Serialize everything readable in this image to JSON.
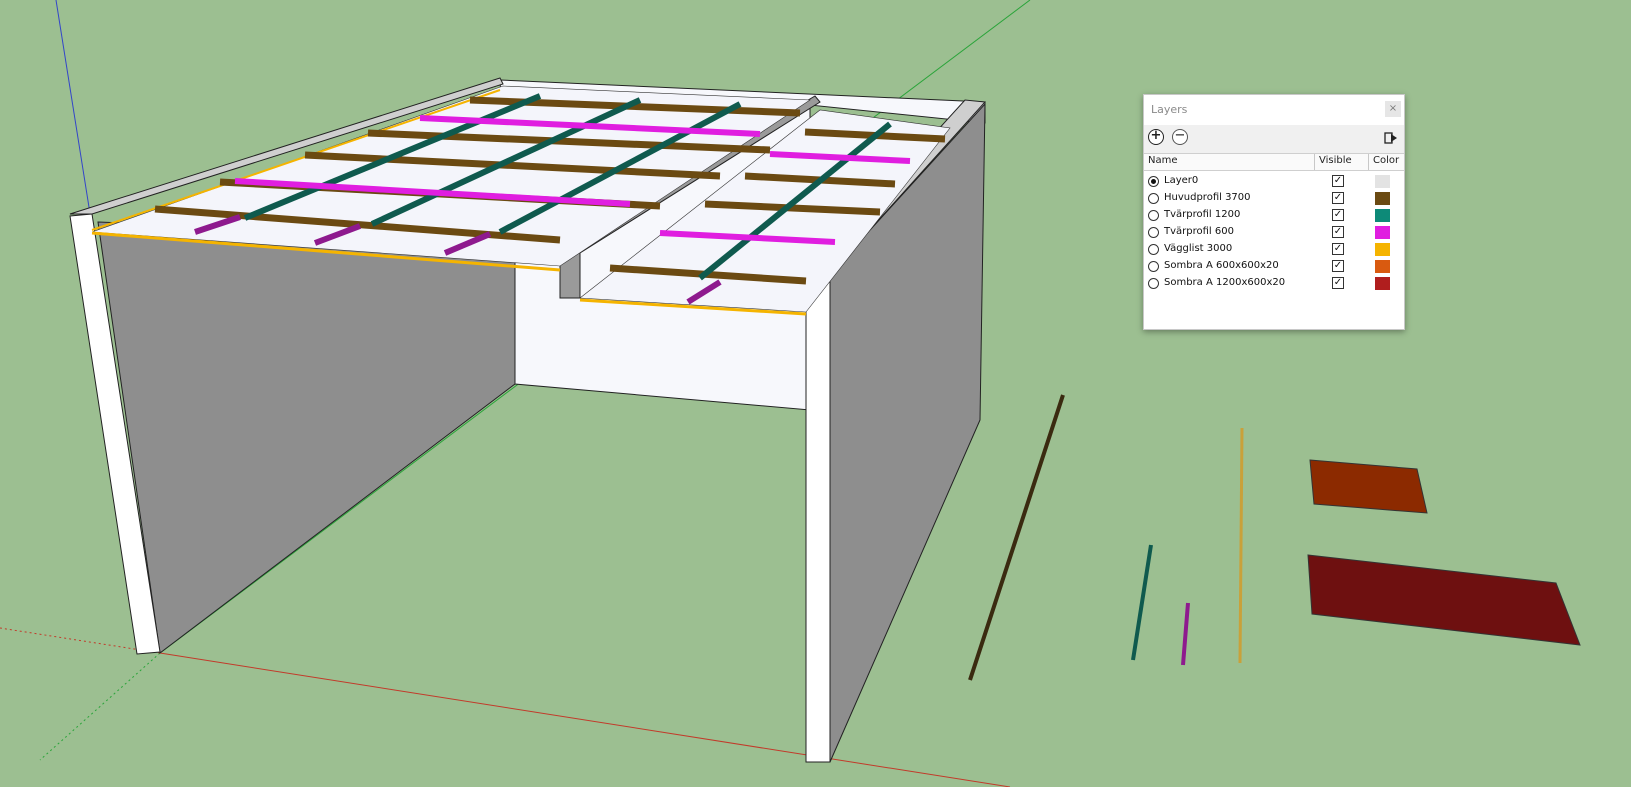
{
  "layers_panel": {
    "title": "Layers",
    "close_glyph": "×",
    "toolbar": {
      "add_glyph": "+",
      "remove_glyph": "−",
      "add_icon": "plus-circle-icon",
      "remove_icon": "minus-circle-icon",
      "details_icon": "details-arrow-icon"
    },
    "columns": {
      "name": "Name",
      "visible": "Visible",
      "color": "Color"
    },
    "check_glyph": "✓",
    "layers": [
      {
        "name": "Layer0",
        "active": true,
        "visible": true,
        "color": "#e3e3e3"
      },
      {
        "name": "Huvudprofil 3700",
        "active": false,
        "visible": true,
        "color": "#6b4a12"
      },
      {
        "name": "Tvärprofil 1200",
        "active": false,
        "visible": true,
        "color": "#0d8a78"
      },
      {
        "name": "Tvärprofil 600",
        "active": false,
        "visible": true,
        "color": "#e01ee0"
      },
      {
        "name": "Vägglist 3000",
        "active": false,
        "visible": true,
        "color": "#f5b400"
      },
      {
        "name": "Sombra A 600x600x20",
        "active": false,
        "visible": true,
        "color": "#d95a10"
      },
      {
        "name": "Sombra A 1200x600x20",
        "active": false,
        "visible": true,
        "color": "#b01e1e"
      }
    ]
  }
}
